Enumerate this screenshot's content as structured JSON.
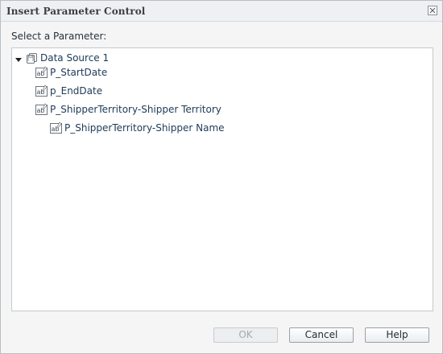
{
  "dialog": {
    "title": "Insert Parameter Control"
  },
  "prompt": "Select a Parameter:",
  "tree": {
    "root": {
      "label": "Data Source 1",
      "icon": "datasource-icon",
      "expanded": true
    },
    "items": [
      {
        "label": "P_StartDate",
        "icon": "text-parameter-icon"
      },
      {
        "label": "p_EndDate",
        "icon": "text-parameter-icon"
      },
      {
        "label": "P_ShipperTerritory-Shipper Territory",
        "icon": "text-parameter-icon"
      },
      {
        "label": "P_ShipperTerritory-Shipper Name",
        "icon": "text-parameter-icon"
      }
    ]
  },
  "buttons": {
    "ok_label": "OK",
    "ok_enabled": false,
    "cancel_label": "Cancel",
    "help_label": "Help"
  }
}
